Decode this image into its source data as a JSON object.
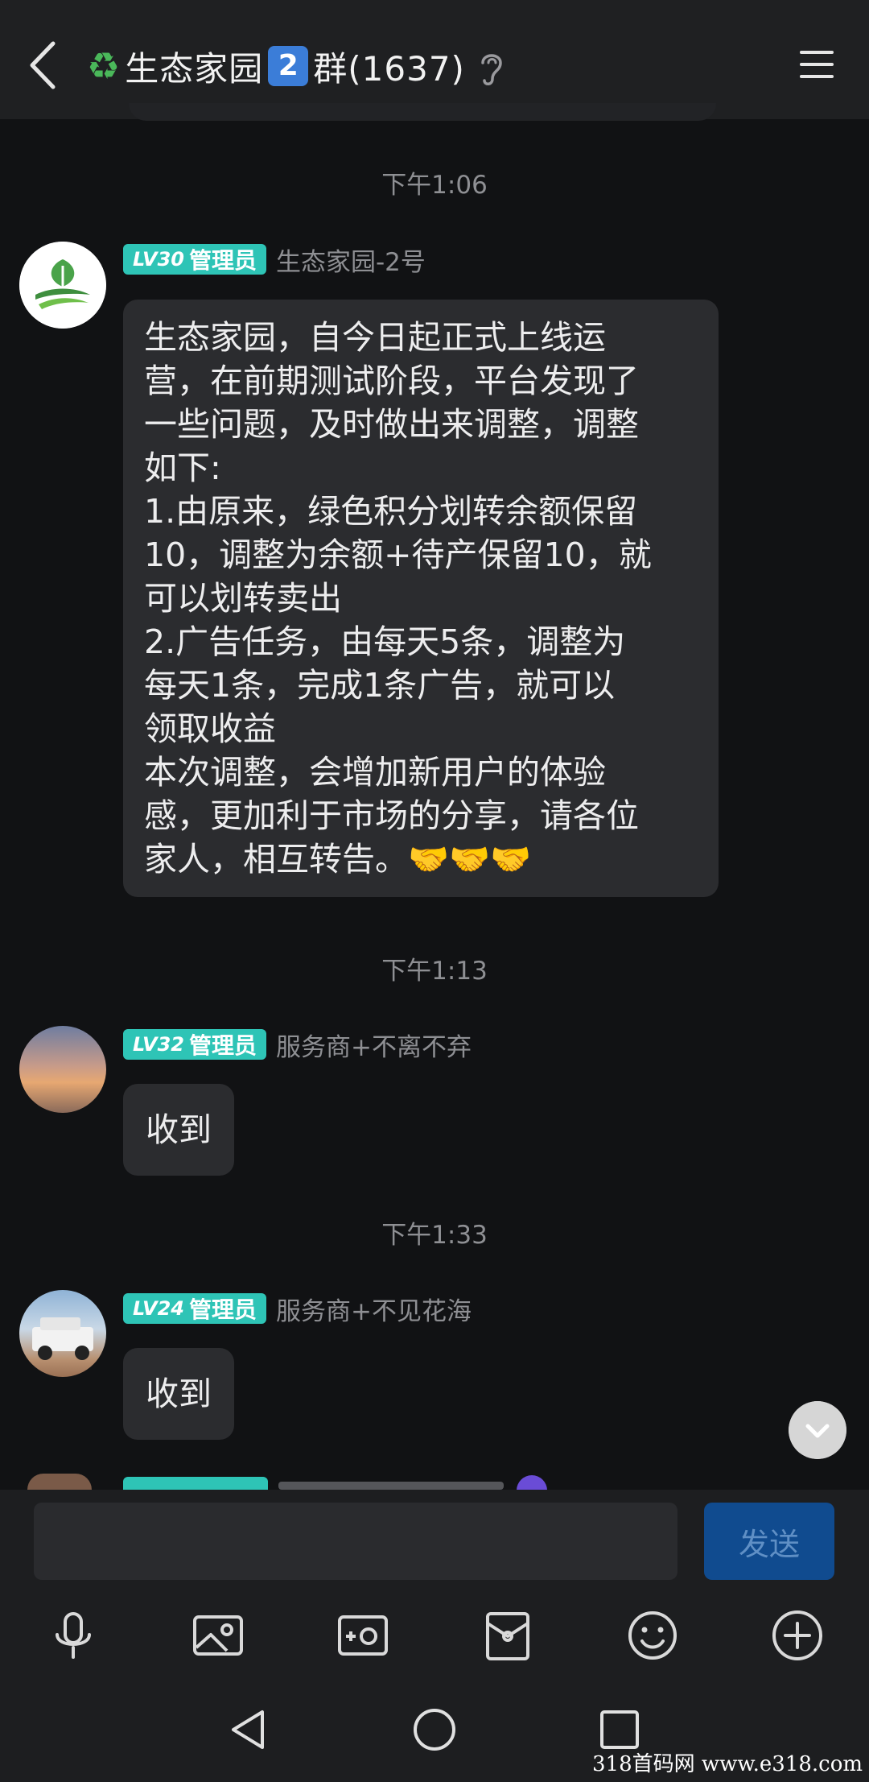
{
  "header": {
    "title": "生态家园",
    "group_number": "2",
    "title_suffix": "群(1637)"
  },
  "messages": [
    {
      "time": "下午1:06",
      "level": "LV30",
      "role": "管理员",
      "sender": "生态家园-2号",
      "lines": [
        "生态家园，自今日起正式上线运",
        "营，在前期测试阶段，平台发现了",
        "一些问题，及时做出来调整，调整",
        "如下:",
        "1.由原来，绿色积分划转余额保留",
        "10，调整为余额+待产保留10，就",
        "可以划转卖出",
        "2.广告任务，由每天5条，调整为",
        "每天1条，完成1条广告，就可以",
        "领取收益",
        "本次调整，会增加新用户的体验",
        "感，更加利于市场的分享，请各位",
        "家人，相互转告。🤝🤝🤝"
      ]
    },
    {
      "time": "下午1:13",
      "level": "LV32",
      "role": "管理员",
      "sender": "服务商+不离不弃",
      "text": "收到"
    },
    {
      "time": "下午1:33",
      "level": "LV24",
      "role": "管理员",
      "sender": "服务商+不见花海",
      "text": "收到"
    }
  ],
  "input": {
    "send_label": "发送"
  },
  "icons": {
    "back": "back-arrow-icon",
    "ear": "ear-icon",
    "menu": "menu-icon",
    "voice": "microphone-icon",
    "image": "image-icon",
    "camera": "camera-icon",
    "redpacket": "red-packet-icon",
    "emoji": "emoji-icon",
    "plus": "plus-icon"
  },
  "watermark": "318首码网 www.e318.com",
  "colors": {
    "level_badge": "#2ec4b6",
    "send_button": "#104b8f",
    "group_badge": "#3b7dd8"
  }
}
